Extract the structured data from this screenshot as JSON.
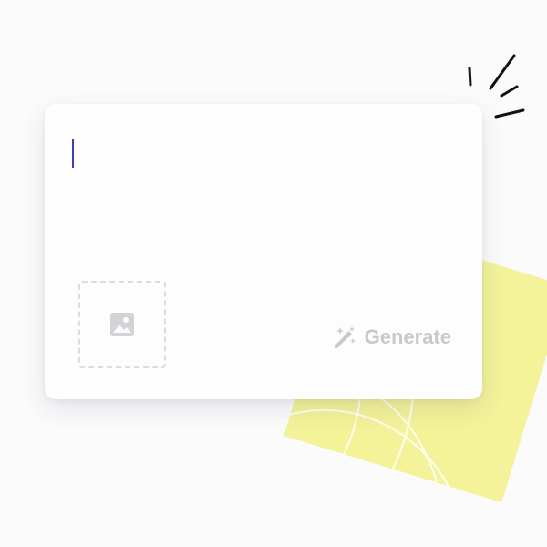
{
  "prompt": {
    "value": "",
    "placeholder": ""
  },
  "image_upload": {
    "icon": "image-icon"
  },
  "generate_button": {
    "label": "Generate",
    "icon": "magic-wand-icon"
  },
  "colors": {
    "caret": "#3b3fb8",
    "yellow_card": "#f4f39a",
    "disabled_text": "#c9c9cd"
  }
}
